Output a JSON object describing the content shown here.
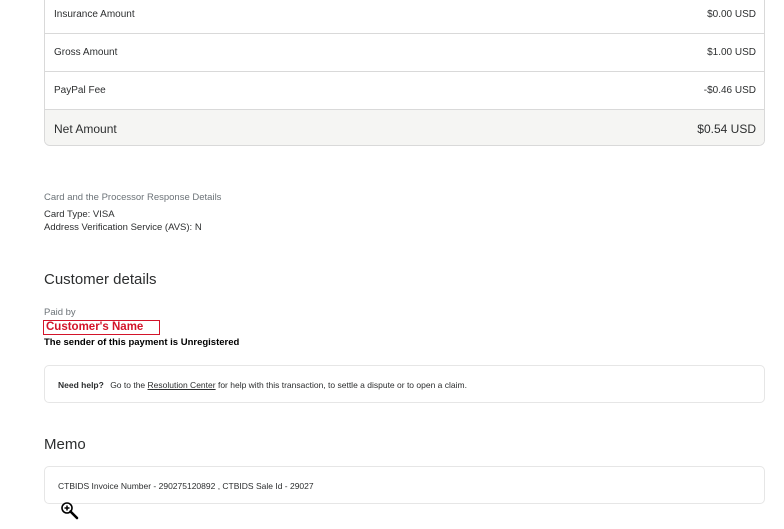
{
  "amounts": {
    "rows": [
      {
        "label": "Insurance Amount",
        "value": "$0.00 USD"
      },
      {
        "label": "Gross Amount",
        "value": "$1.00 USD"
      },
      {
        "label": "PayPal Fee",
        "value": "-$0.46 USD"
      }
    ],
    "net": {
      "label": "Net Amount",
      "value": "$0.54 USD"
    }
  },
  "card_details": {
    "caption": "Card and the Processor Response Details",
    "card_type": "Card Type: VISA",
    "avs": "Address Verification Service (AVS): N"
  },
  "customer": {
    "heading": "Customer details",
    "paid_by_label": "Paid by",
    "name": "Customer's Name",
    "status": "The sender of this payment is Unregistered"
  },
  "help": {
    "strong": "Need help?",
    "pre": "Go to the",
    "link": "Resolution Center",
    "post": "for help with this transaction, to settle a dispute or to open a claim."
  },
  "memo": {
    "heading": "Memo",
    "text": "CTBIDS Invoice Number - 290275120892 , CTBIDS Sale Id - 29027"
  },
  "icons": {
    "zoom": "zoom-in-icon"
  }
}
